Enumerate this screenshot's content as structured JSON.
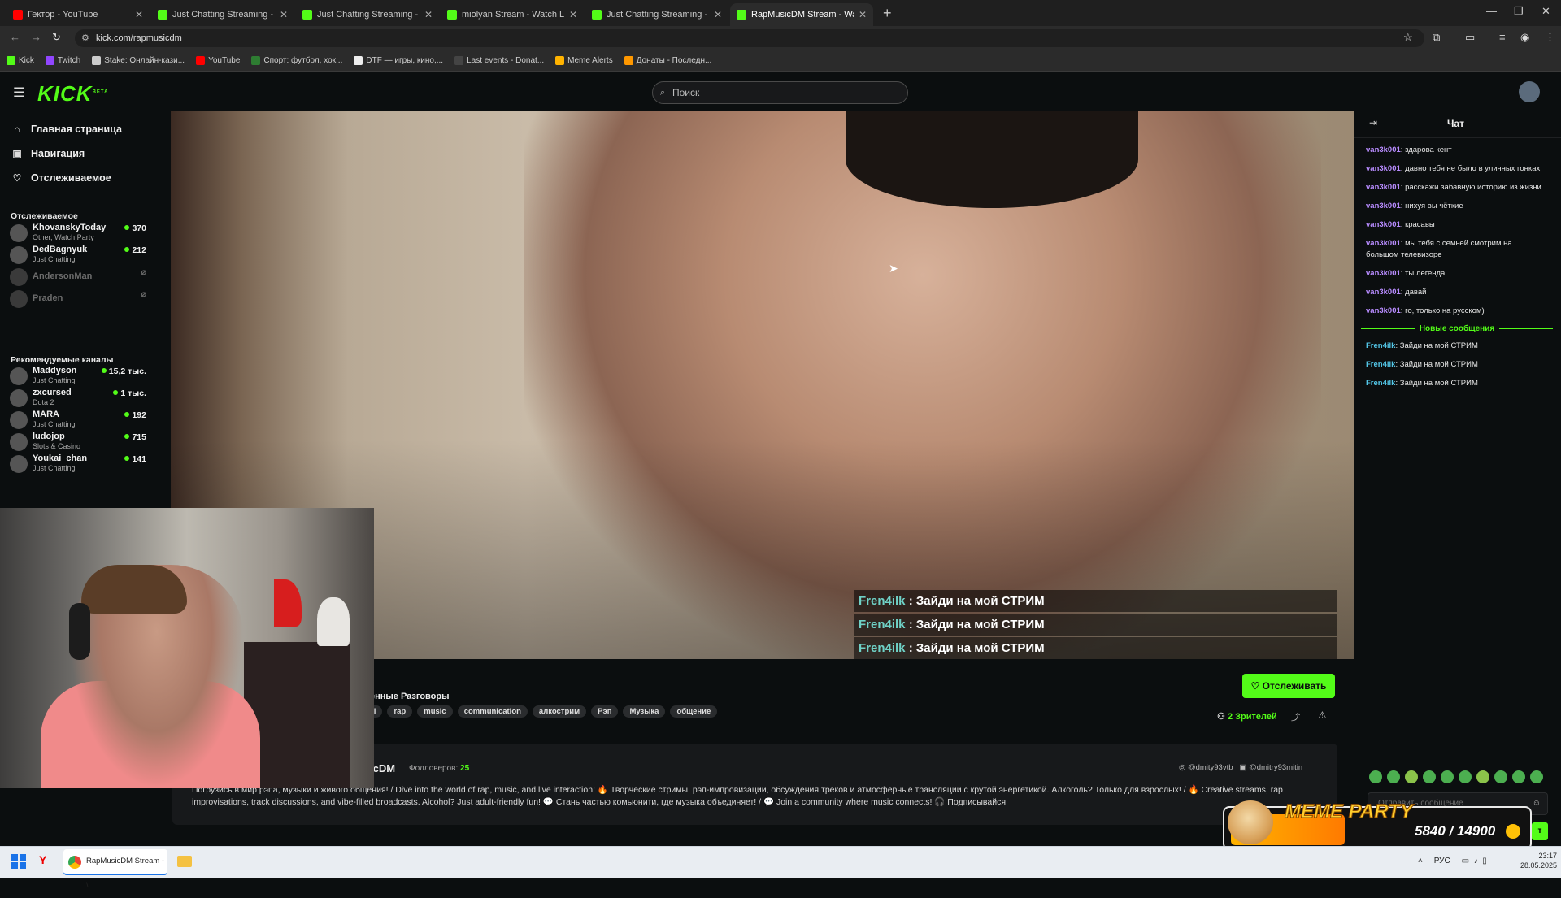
{
  "browser": {
    "tabs": [
      {
        "title": "Гектор - YouTube",
        "favicon_color": "#ff0000",
        "active": false
      },
      {
        "title": "Just Chatting Streaming - Live S",
        "favicon_color": "#53fc18",
        "active": false
      },
      {
        "title": "Just Chatting Streaming - Live S",
        "favicon_color": "#53fc18",
        "active": false
      },
      {
        "title": "miolyan Stream - Watch Live on",
        "favicon_color": "#53fc18",
        "active": false
      },
      {
        "title": "Just Chatting Streaming - Live S",
        "favicon_color": "#53fc18",
        "active": false
      },
      {
        "title": "RapMusicDM Stream - Wat",
        "favicon_color": "#53fc18",
        "active": true
      }
    ],
    "address": "kick.com/rapmusicdm",
    "bookmarks": [
      {
        "label": "Kick",
        "color": "#53fc18"
      },
      {
        "label": "Twitch",
        "color": "#9146ff"
      },
      {
        "label": "Stake: Онлайн-кази...",
        "color": "#cccccc"
      },
      {
        "label": "YouTube",
        "color": "#ff0000"
      },
      {
        "label": "Спорт: футбол, хок...",
        "color": "#2e7d32"
      },
      {
        "label": "DTF — игры, кино,...",
        "color": "#eeeeee"
      },
      {
        "label": "Last events - Donat...",
        "color": "#444444"
      },
      {
        "label": "Meme Alerts",
        "color": "#ffb300"
      },
      {
        "label": "Донаты - Последн...",
        "color": "#ff9800"
      }
    ]
  },
  "kick": {
    "logo": "KICK",
    "logo_badge": "BETA",
    "search_placeholder": "Поиск",
    "nav": [
      {
        "label": "Главная страница",
        "icon": "home-icon"
      },
      {
        "label": "Навигация",
        "icon": "compass-icon"
      },
      {
        "label": "Отслеживаемое",
        "icon": "heart-icon"
      }
    ],
    "following_title": "Отслеживаемое",
    "following": [
      {
        "name": "KhovanskyToday",
        "category": "Other, Watch Party",
        "viewers": "370",
        "live": true
      },
      {
        "name": "DedBagnyuk",
        "category": "Just Chatting",
        "viewers": "212",
        "live": true
      },
      {
        "name": "AndersonMan",
        "category": "",
        "viewers": "",
        "live": false
      },
      {
        "name": "Praden",
        "category": "",
        "viewers": "",
        "live": false
      }
    ],
    "recommended_title": "Рекомендуемые каналы",
    "recommended": [
      {
        "name": "Maddyson",
        "category": "Just Chatting",
        "viewers": "15,2 тыс."
      },
      {
        "name": "zxcursed",
        "category": "Dota 2",
        "viewers": "1 тыс."
      },
      {
        "name": "MARA",
        "category": "Just Chatting",
        "viewers": "192"
      },
      {
        "name": "ludojop",
        "category": "Slots & Casino",
        "viewers": "715"
      },
      {
        "name": "Youkai_chan",
        "category": "Just Chatting",
        "viewers": "141"
      }
    ]
  },
  "stream": {
    "overlay_chat": [
      {
        "user": "Fren4ilk",
        "text": " : Зайди на мой СТРИМ"
      },
      {
        "user": "Fren4ilk",
        "text": " : Зайди на мой СТРИМ"
      },
      {
        "user": "Fren4ilk",
        "text": " : Зайди на мой СТРИМ"
      }
    ],
    "category": "енные Разговоры",
    "tags": [
      "ol",
      "rap",
      "music",
      "communication",
      "алкострим",
      "Рэп",
      "Музыка",
      "общение"
    ],
    "follow_label": "Отслеживать",
    "viewers_count": "2",
    "viewers_label": "Зрителей",
    "channel_name": "icDM",
    "followers_label": "Фолловеров:",
    "followers_count": "25",
    "social_1": "@dmity93vtb",
    "social_2": "@dmitry93mitin",
    "bio": "Погрузись в мир рэпа, музыки и живого общения! / Dive into the world of rap, music, and live interaction! 🔥 Творческие стримы, рэп-импровизации, обсуждения треков и атмосферные трансляции с крутой энергетикой. Алкоголь? Только для взрослых! / 🔥 Creative streams, rap improvisations, track discussions, and vibe-filled broadcasts. Alcohol? Just adult-friendly fun! 💬 Стань частью комьюнити, где музыка объединяет! / 💬 Join a community where music connects! 🎧 Подписывайся"
  },
  "chat": {
    "title": "Чат",
    "messages": [
      {
        "user": "van3k001",
        "text": ": здарова кент"
      },
      {
        "user": "van3k001",
        "text": ": давно тебя не было в уличных гонках"
      },
      {
        "user": "van3k001",
        "text": ": расскажи забавную историю из жизни"
      },
      {
        "user": "van3k001",
        "text": ": нихуя вы чёткие"
      },
      {
        "user": "van3k001",
        "text": ": красавы"
      },
      {
        "user": "van3k001",
        "text": ": мы тебя с семьей смотрим на большом телевизоре"
      },
      {
        "user": "van3k001",
        "text": ": ты легенда"
      },
      {
        "user": "van3k001",
        "text": ": давай"
      },
      {
        "user": "van3k001",
        "text": ": го, только на русском)"
      }
    ],
    "new_messages_label": "Новые сообщения",
    "new_messages": [
      {
        "user": "Fren4ilk",
        "text": ": Зайди на мой СТРИМ"
      },
      {
        "user": "Fren4ilk",
        "text": ": Зайди на мой СТРИМ"
      },
      {
        "user": "Fren4ilk",
        "text": ": Зайди на мой СТРИМ"
      }
    ],
    "input_placeholder": "Отправить сообщение",
    "send_label": "т"
  },
  "meme_party": {
    "title": "MEME PARTY",
    "progress": "5840 / 14900",
    "progress_fraction": 0.39
  },
  "taskbar": {
    "chrome_label": "RapMusicDM Stream - \\",
    "lang": "РУС",
    "time": "23:17",
    "date": "28.05.2025"
  }
}
